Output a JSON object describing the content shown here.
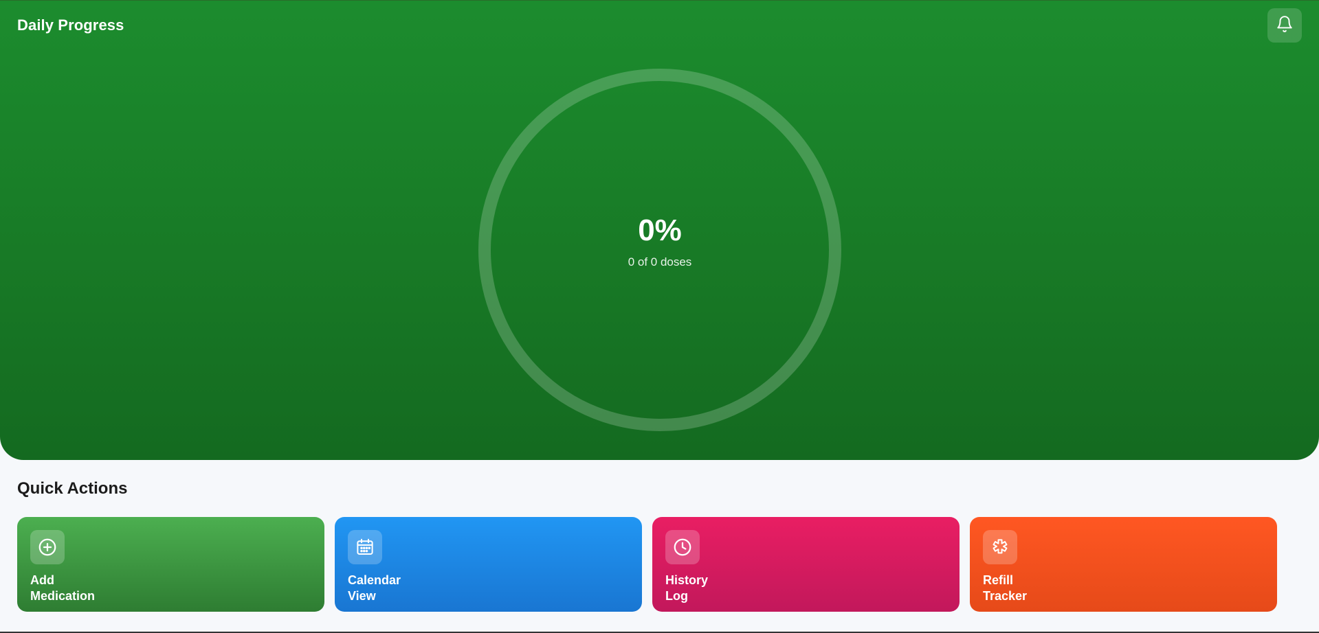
{
  "header": {
    "title": "Daily Progress",
    "notification_icon": "bell-icon"
  },
  "progress": {
    "percent_text": "0%",
    "percent_value": 0,
    "doses_text": "0 of 0 doses",
    "ring_color": "#ffffff"
  },
  "quick_actions": {
    "title": "Quick Actions",
    "items": [
      {
        "line1": "Add",
        "line2": "Medication",
        "icon": "plus-circle-icon",
        "color": "#4caf50"
      },
      {
        "line1": "Calendar",
        "line2": "View",
        "icon": "calendar-icon",
        "color": "#2196f3"
      },
      {
        "line1": "History",
        "line2": "Log",
        "icon": "clock-icon",
        "color": "#e91e63"
      },
      {
        "line1": "Refill",
        "line2": "Tracker",
        "icon": "pill-icon",
        "color": "#ff5722"
      }
    ]
  }
}
